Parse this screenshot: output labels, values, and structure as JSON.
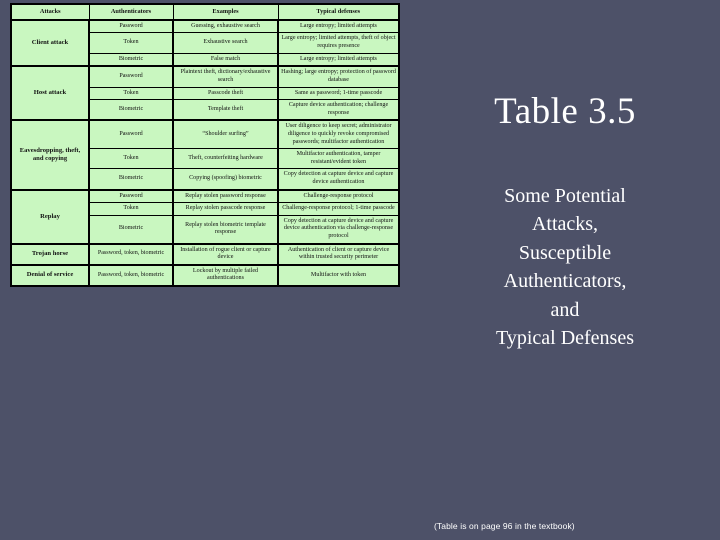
{
  "slide": {
    "title": "Table 3.5",
    "subtitle_lines": [
      "Some Potential",
      "Attacks,",
      "Susceptible",
      "Authenticators,",
      "and",
      "Typical Defenses"
    ],
    "footnote": "(Table is on page 96 in the textbook)",
    "background_color": "#4d5168",
    "text_color": "#ffffff",
    "table_fill_color": "#c9f7c0"
  },
  "table": {
    "headers": [
      "Attacks",
      "Authenticators",
      "Examples",
      "Typical defenses"
    ],
    "groups": [
      {
        "attack": "Client attack",
        "rows": [
          {
            "authenticator": "Password",
            "example": "Guessing, exhaustive search",
            "defense": "Large entropy; limited attempts"
          },
          {
            "authenticator": "Token",
            "example": "Exhaustive search",
            "defense": "Large entropy; limited attempts, theft of object requires presence"
          },
          {
            "authenticator": "Biometric",
            "example": "False match",
            "defense": "Large entropy; limited attempts"
          }
        ]
      },
      {
        "attack": "Host attack",
        "rows": [
          {
            "authenticator": "Password",
            "example": "Plaintext theft, dictionary/exhaustive search",
            "defense": "Hashing; large entropy; protection of password database"
          },
          {
            "authenticator": "Token",
            "example": "Passcode theft",
            "defense": "Same as password; 1-time passcode"
          },
          {
            "authenticator": "Biometric",
            "example": "Template theft",
            "defense": "Capture device authentication; challenge response"
          }
        ]
      },
      {
        "attack": "Eavesdropping, theft, and copying",
        "rows": [
          {
            "authenticator": "Password",
            "example": "“Shoulder surfing”",
            "defense": "User diligence to keep secret; administrator diligence to quickly revoke compromised passwords; multifactor authentication"
          },
          {
            "authenticator": "Token",
            "example": "Theft, counterfeiting hardware",
            "defense": "Multifactor authentication, tamper resistant/evident token"
          },
          {
            "authenticator": "Biometric",
            "example": "Copying (spoofing) biometric",
            "defense": "Copy detection at capture device and capture device authentication"
          }
        ]
      },
      {
        "attack": "Replay",
        "rows": [
          {
            "authenticator": "Password",
            "example": "Replay stolen password response",
            "defense": "Challenge-response protocol"
          },
          {
            "authenticator": "Token",
            "example": "Replay stolen passcode response",
            "defense": "Challenge-response protocol; 1-time passcode"
          },
          {
            "authenticator": "Biometric",
            "example": "Replay stolen biometric template response",
            "defense": "Copy detection at capture device and capture device authentication via challenge-response protocol"
          }
        ]
      },
      {
        "attack": "Trojan horse",
        "rows": [
          {
            "authenticator": "Password, token, biometric",
            "example": "Installation of rogue client or capture device",
            "defense": "Authentication of client or capture device within trusted security perimeter"
          }
        ]
      },
      {
        "attack": "Denial of service",
        "rows": [
          {
            "authenticator": "Password, token, biometric",
            "example": "Lockout by multiple failed authentications",
            "defense": "Multifactor with token"
          }
        ]
      }
    ]
  }
}
